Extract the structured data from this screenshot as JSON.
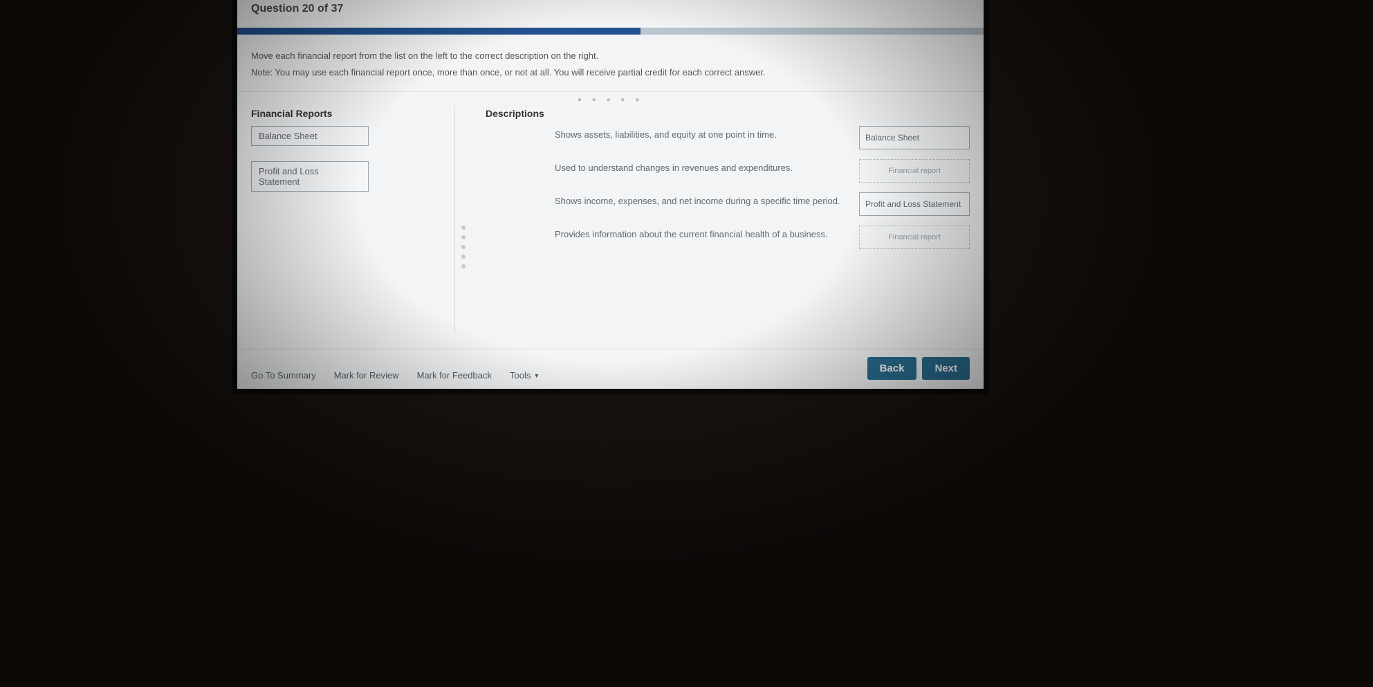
{
  "header": {
    "question_label": "Question 20 of 37",
    "progress_percent": 54
  },
  "instructions": {
    "line1": "Move each financial report from the list on the left to the correct description on the right.",
    "line2": "Note: You may use each financial report once, more than once, or not at all. You will receive partial credit for each correct answer."
  },
  "left": {
    "heading": "Financial Reports",
    "items": [
      {
        "label": "Balance Sheet"
      },
      {
        "label": "Profit and Loss Statement"
      }
    ]
  },
  "right": {
    "heading": "Descriptions",
    "empty_placeholder": "Financial report",
    "rows": [
      {
        "text": "Shows assets, liabilities, and equity at one point in time.",
        "answer": "Balance Sheet",
        "filled": true
      },
      {
        "text": "Used to understand changes in revenues and expenditures.",
        "answer": "",
        "filled": false
      },
      {
        "text": "Shows income, expenses, and net income during a specific time period.",
        "answer": "Profit and Loss Statement",
        "filled": true
      },
      {
        "text": "Provides information about the current financial health of a business.",
        "answer": "",
        "filled": false
      }
    ]
  },
  "footer": {
    "summary": "Go To Summary",
    "review": "Mark for Review",
    "feedback": "Mark for Feedback",
    "tools": "Tools",
    "back": "Back",
    "next": "Next"
  }
}
